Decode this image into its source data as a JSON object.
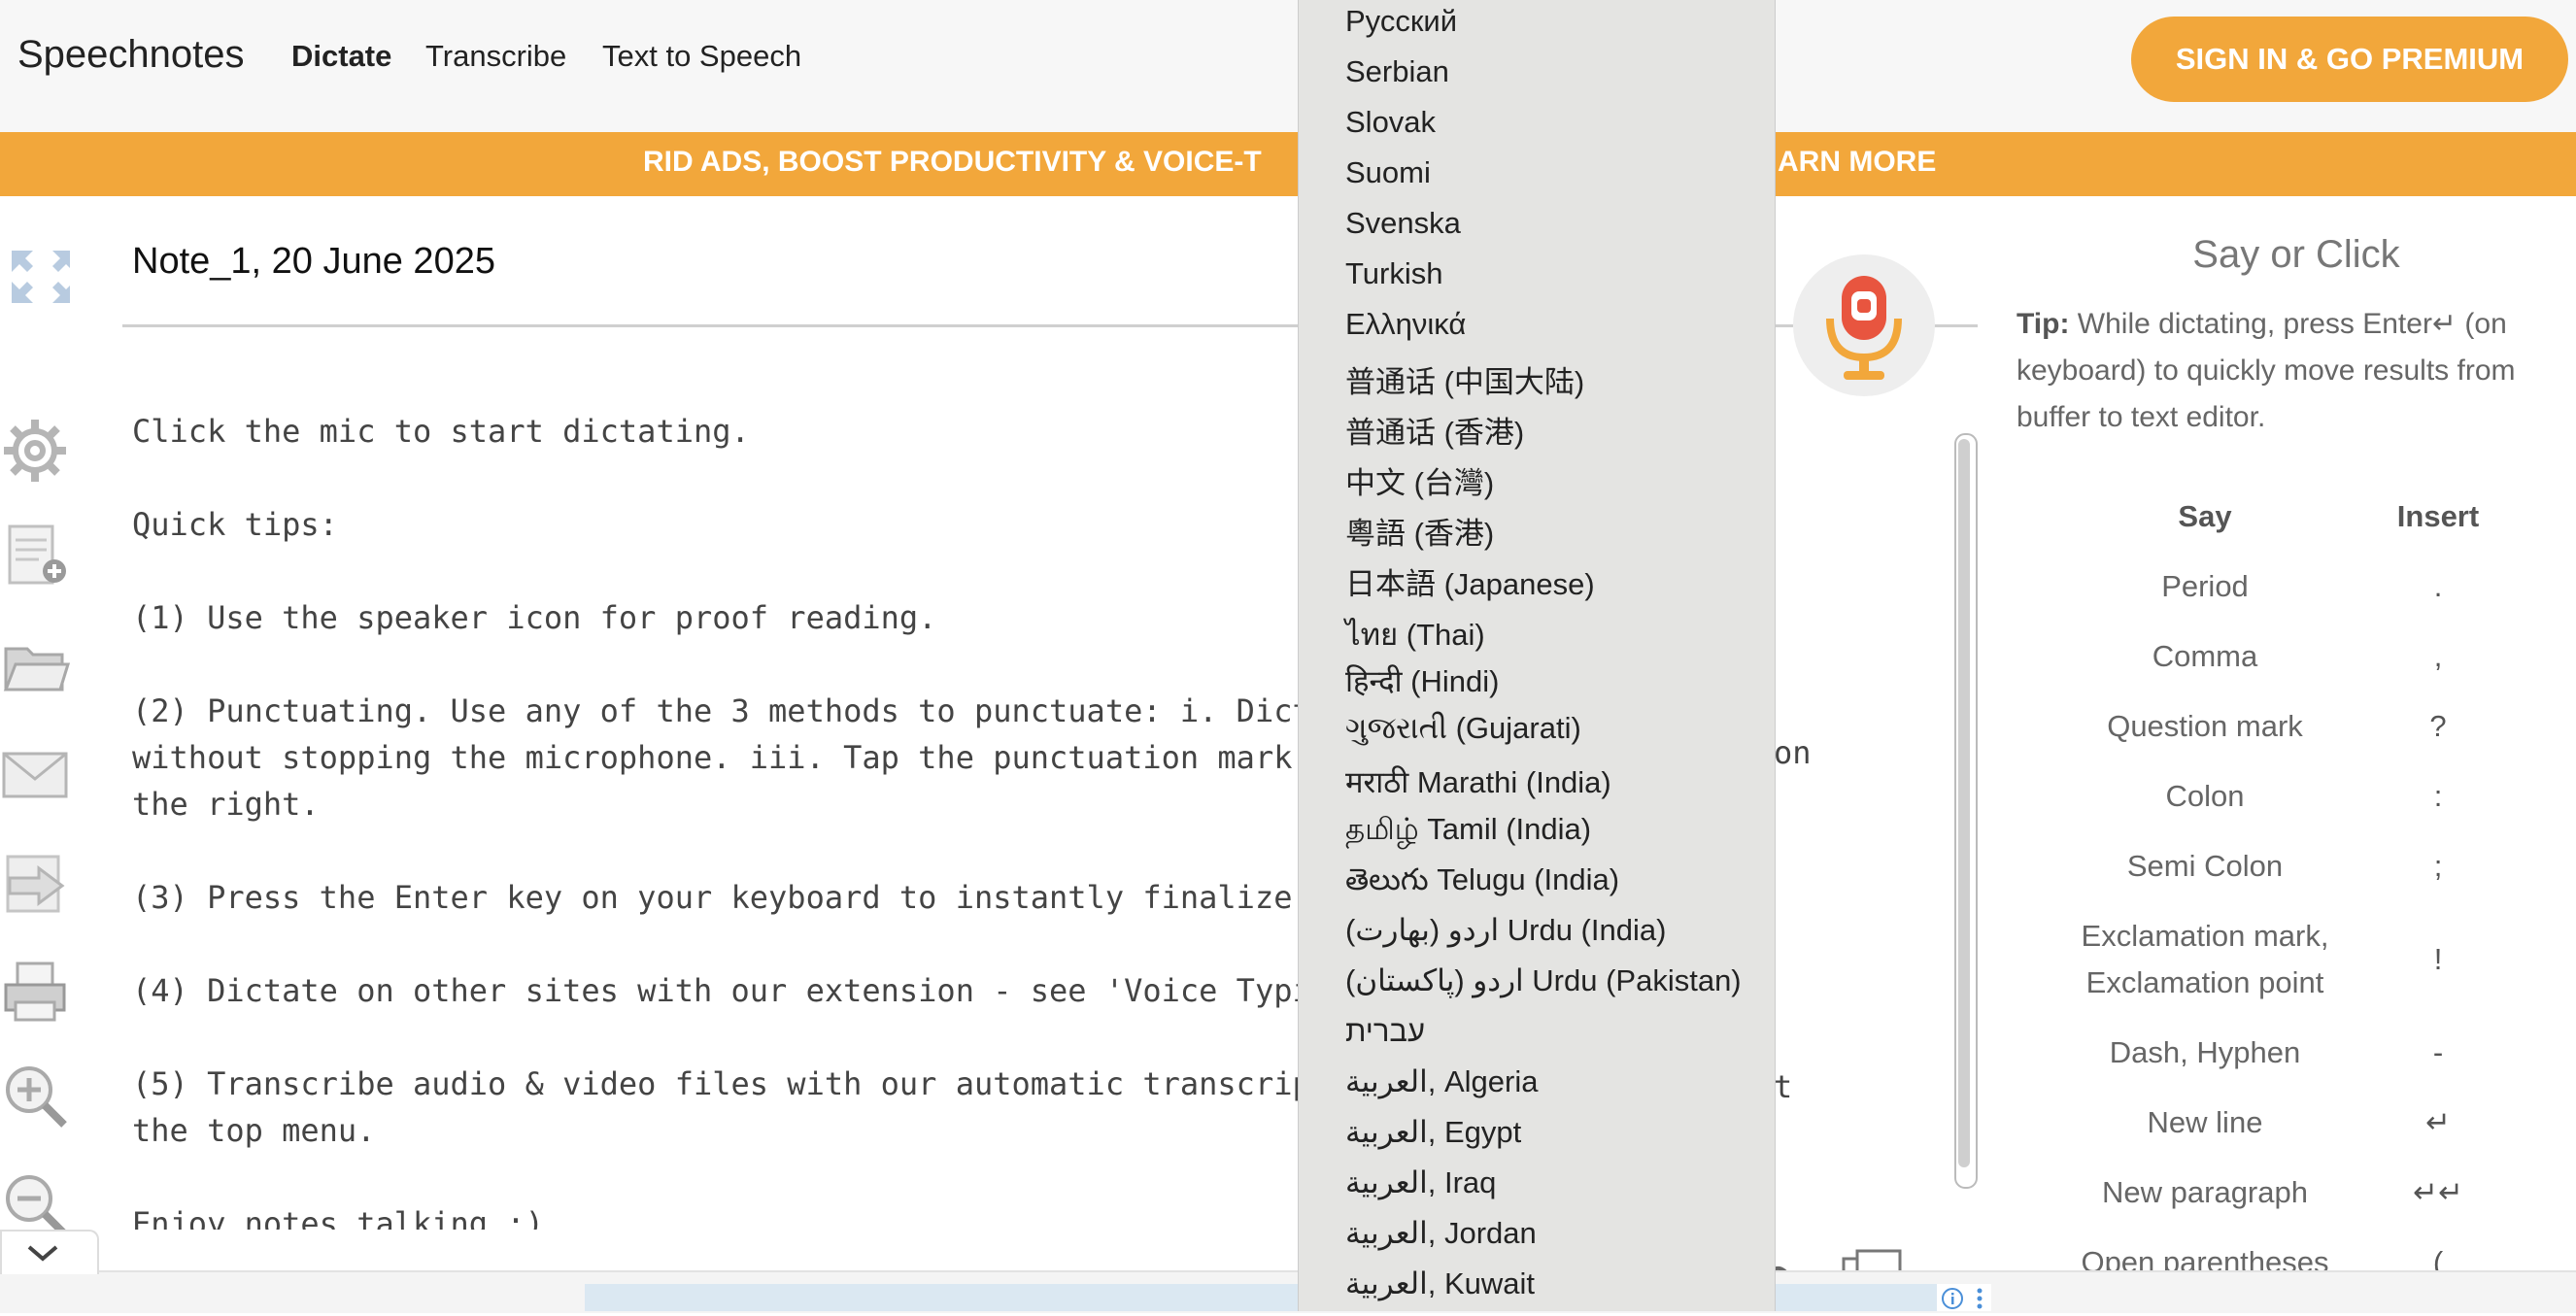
{
  "header": {
    "logo": "Speechnotes",
    "nav": [
      "Dictate",
      "Transcribe",
      "Text to Speech"
    ],
    "signin_button": "SIGN IN & GO PREMIUM"
  },
  "banner": {
    "text_left": "RID ADS, BOOST PRODUCTIVITY & VOICE-T",
    "text_right": "ARN MORE"
  },
  "note": {
    "title": "Note_1, 20 June 2025",
    "body": "Click the mic to start dictating.\n\nQuick tips:\n\n(1) Use the speaker icon for proof reading.\n\n(2) Punctuating. Use any of the 3 methods to punctuate: i. Dict\nwithout stopping the microphone. iii. Tap the punctuation mark \nthe right.\n\n(3) Press the Enter key on your keyboard to instantly finalize \n\n(4) Dictate on other sites with our extension - see 'Voice Typi\n\n(5) Transcribe audio & video files with our automatic transcrip\nthe top menu.\n\nEnjoy notes talking :)",
    "body_tail_line5": "on",
    "body_tail_line9": "t"
  },
  "sidebar_icons": [
    "fullscreen-icon",
    "settings-icon",
    "new-note-icon",
    "open-folder-icon",
    "email-icon",
    "export-icon",
    "print-icon",
    "zoom-in-icon",
    "zoom-out-icon",
    "chevron-down-icon"
  ],
  "commands_panel": {
    "title": "Say or Click",
    "tip_label": "Tip:",
    "tip_text": " While dictating, press Enter↵ (on keyboard) to quickly move results from buffer to text editor.",
    "col_say": "Say",
    "col_insert": "Insert",
    "rows": [
      {
        "say": "Period",
        "insert": "."
      },
      {
        "say": "Comma",
        "insert": ","
      },
      {
        "say": "Question mark",
        "insert": "?"
      },
      {
        "say": "Colon",
        "insert": ":"
      },
      {
        "say": "Semi Colon",
        "insert": ";"
      },
      {
        "say": "Exclamation mark, Exclamation point",
        "insert": "!"
      },
      {
        "say": "Dash, Hyphen",
        "insert": "-"
      },
      {
        "say": "New line",
        "insert": "↵"
      },
      {
        "say": "New paragraph",
        "insert": "↵↵"
      },
      {
        "say": "Open parentheses",
        "insert": "("
      }
    ]
  },
  "language_dropdown": {
    "items": [
      "Русский",
      "Serbian",
      "Slovak",
      "Suomi",
      "Svenska",
      "Turkish",
      "Ελληνικά",
      "普通话 (中国大陆)",
      "普通话 (香港)",
      "中文 (台灣)",
      "粵語 (香港)",
      "日本語 (Japanese)",
      "ไทย (Thai)",
      "हिन्दी (Hindi)",
      "ગુજરાતી (Gujarati)",
      "मराठी Marathi (India)",
      "தமிழ் Tamil (India)",
      "తెలుగు Telugu (India)",
      "اردو (بھارت) Urdu (India)",
      "اردو (پاکستان) Urdu (Pakistan)",
      "עברית",
      "العربية, Algeria",
      "العربية, Egypt",
      "العربية, Iraq",
      "العربية, Jordan",
      "العربية, Kuwait"
    ]
  },
  "colors": {
    "accent": "#f2a73b",
    "mic_red": "#e8553f",
    "mic_orange": "#f2a73b",
    "dropdown_bg": "#e4e4e2"
  }
}
